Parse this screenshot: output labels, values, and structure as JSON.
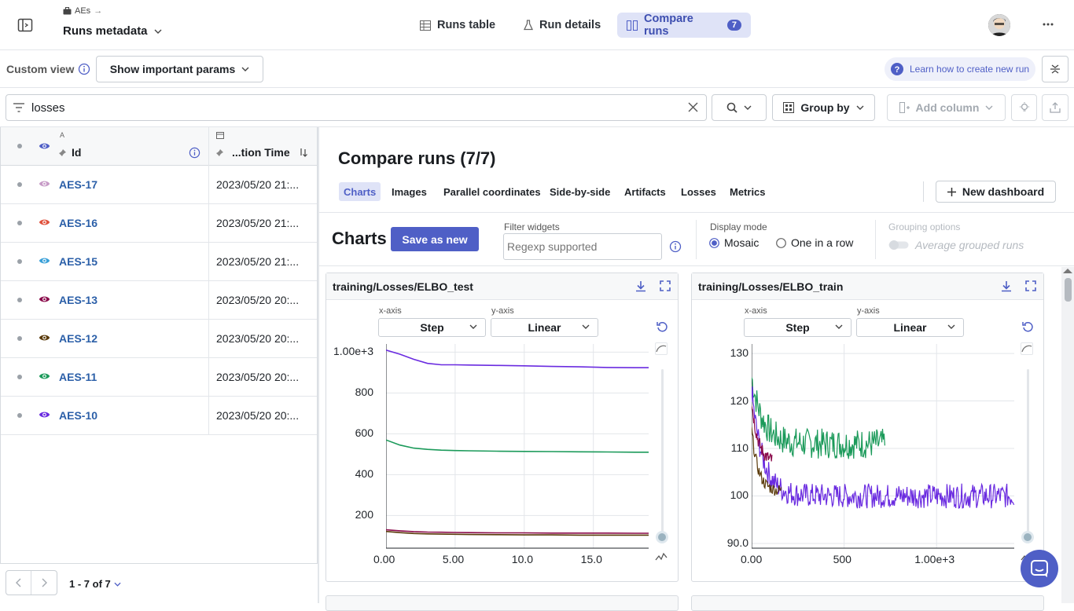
{
  "header": {
    "project_path": "AEs",
    "title": "Runs metadata",
    "tabs": [
      {
        "label": "Runs table"
      },
      {
        "label": "Run details"
      },
      {
        "label": "Compare runs",
        "badge": "7"
      }
    ]
  },
  "view_bar": {
    "custom_view_label": "Custom view",
    "view_select": "Show important params",
    "learn_link": "Learn how to create new run"
  },
  "query_bar": {
    "search_value": "losses",
    "group_by": "Group by",
    "add_column": "Add column"
  },
  "table": {
    "col_id_top": "A",
    "col_id": "Id",
    "col_time": "...tion Time",
    "rows": [
      {
        "id": "AES-17",
        "time": "2023/05/20 21:...",
        "color": "#c79bc7"
      },
      {
        "id": "AES-16",
        "time": "2023/05/20 21:...",
        "color": "#e0523d"
      },
      {
        "id": "AES-15",
        "time": "2023/05/20 21:...",
        "color": "#3aa0d8"
      },
      {
        "id": "AES-13",
        "time": "2023/05/20 20:...",
        "color": "#8a0a4a"
      },
      {
        "id": "AES-12",
        "time": "2023/05/20 20:...",
        "color": "#5a3a0a"
      },
      {
        "id": "AES-11",
        "time": "2023/05/20 20:...",
        "color": "#1b9a5a"
      },
      {
        "id": "AES-10",
        "time": "2023/05/20 20:...",
        "color": "#6a2be0"
      }
    ],
    "pagination": "1 - 7 of 7"
  },
  "compare": {
    "title": "Compare runs (7/7)",
    "tabs": [
      "Charts",
      "Images",
      "Parallel coordinates",
      "Side-by-side",
      "Artifacts",
      "Losses",
      "Metrics"
    ],
    "new_dashboard": "New dashboard",
    "charts_heading": "Charts",
    "save_as_new": "Save as new",
    "filter_label": "Filter widgets",
    "filter_placeholder": "Regexp supported",
    "display_mode_label": "Display mode",
    "mode_mosaic": "Mosaic",
    "mode_row": "One in a row",
    "grouping_label": "Grouping options",
    "average_label": "Average grouped runs"
  },
  "charts": [
    {
      "title": "training/Losses/ELBO_test",
      "xaxis_label": "x-axis",
      "yaxis_label": "y-axis",
      "xaxis_value": "Step",
      "yaxis_value": "Linear",
      "yticks": [
        "1.00e+3",
        "800",
        "600",
        "400",
        "200"
      ],
      "xticks": [
        "0.00",
        "5.00",
        "10.0",
        "15.0"
      ]
    },
    {
      "title": "training/Losses/ELBO_train",
      "xaxis_label": "x-axis",
      "yaxis_label": "y-axis",
      "xaxis_value": "Step",
      "yaxis_value": "Linear",
      "yticks": [
        "130",
        "120",
        "110",
        "100",
        "90.0"
      ],
      "xticks": [
        "0.00",
        "500",
        "1.00e+3"
      ]
    }
  ],
  "chart_data": [
    {
      "type": "line",
      "title": "training/Losses/ELBO_test",
      "xlabel": "",
      "ylabel": "",
      "xlim": [
        0,
        19
      ],
      "ylim": [
        40,
        1040
      ],
      "x": [
        0,
        1,
        2,
        3,
        4,
        5,
        6,
        8,
        10,
        12,
        14,
        16,
        18,
        19
      ],
      "series": [
        {
          "name": "AES-10",
          "color": "#6a2be0",
          "values": [
            1010,
            990,
            965,
            945,
            938,
            938,
            937,
            935,
            933,
            930,
            928,
            925,
            924,
            924
          ]
        },
        {
          "name": "AES-11",
          "color": "#1b9a5a",
          "values": [
            570,
            545,
            530,
            524,
            520,
            518,
            517,
            515,
            514,
            513,
            512,
            511,
            510,
            510
          ]
        },
        {
          "name": "AES-13",
          "color": "#8a0a4a",
          "values": [
            130,
            125,
            121,
            119,
            118,
            117,
            116,
            115,
            115,
            114,
            114,
            114,
            113,
            113
          ]
        },
        {
          "name": "AES-12",
          "color": "#5a3a0a",
          "values": [
            122,
            116,
            112,
            110,
            109,
            108,
            107,
            106,
            105,
            105,
            104,
            104,
            104,
            104
          ]
        }
      ]
    },
    {
      "type": "line",
      "title": "training/Losses/ELBO_train",
      "xlabel": "",
      "ylabel": "",
      "xlim": [
        0,
        1420
      ],
      "ylim": [
        89,
        132
      ],
      "series": [
        {
          "name": "AES-11",
          "color": "#1b9a5a",
          "x_end": 720,
          "start": 125,
          "plateau": 111,
          "noise": 3.2
        },
        {
          "name": "AES-10",
          "color": "#6a2be0",
          "x_end": 1420,
          "start": 122,
          "plateau": 100,
          "noise": 2.6
        },
        {
          "name": "AES-13",
          "color": "#8a0a4a",
          "x_end": 110,
          "start": 120,
          "plateau": 107,
          "noise": 1.5
        },
        {
          "name": "AES-12",
          "color": "#5a3a0a",
          "x_end": 160,
          "start": 114,
          "plateau": 101,
          "noise": 1.3
        }
      ]
    }
  ]
}
